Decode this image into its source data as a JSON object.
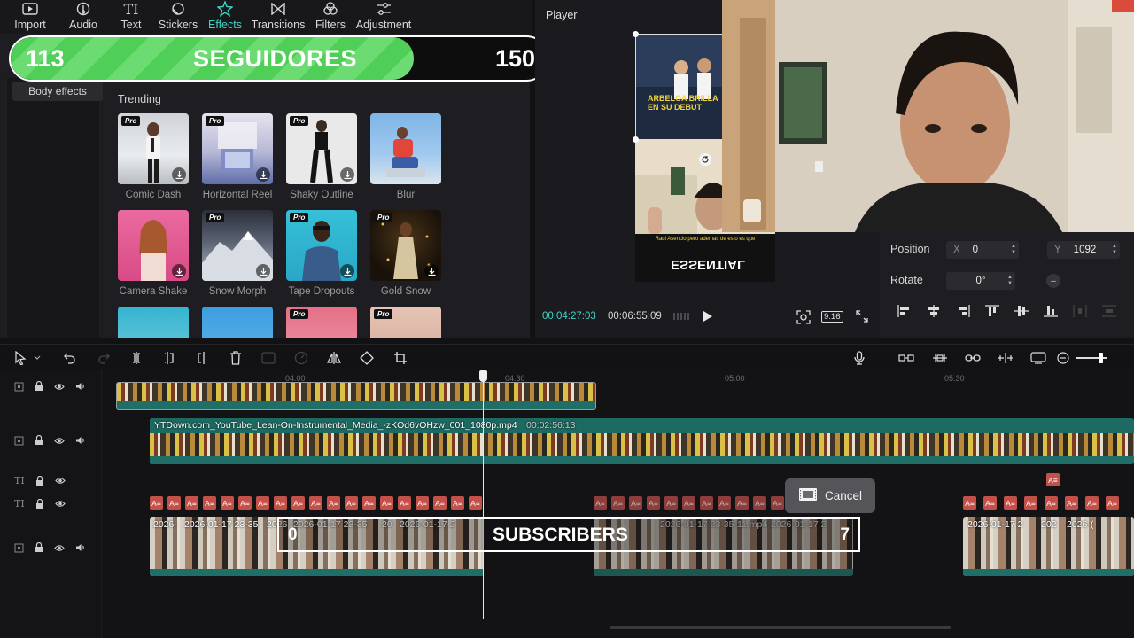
{
  "toolbar": {
    "tabs": [
      {
        "label": "Import",
        "icon": "import-icon"
      },
      {
        "label": "Audio",
        "icon": "audio-icon"
      },
      {
        "label": "Text",
        "icon": "text-icon"
      },
      {
        "label": "Stickers",
        "icon": "stickers-icon"
      },
      {
        "label": "Effects",
        "icon": "effects-icon",
        "active": true
      },
      {
        "label": "Transitions",
        "icon": "transitions-icon"
      },
      {
        "label": "Filters",
        "icon": "filters-icon"
      },
      {
        "label": "Adjustment",
        "icon": "adjustment-icon"
      }
    ]
  },
  "counter": {
    "start": "113",
    "title": "SEGUIDORES",
    "end": "150",
    "progress_fraction": 0.75,
    "fill_color": "#4fcf57"
  },
  "effects_panel": {
    "category": "Body effects",
    "section_title": "Trending",
    "items": [
      {
        "name": "Comic Dash",
        "pro": true
      },
      {
        "name": "Horizontal Reel",
        "pro": true
      },
      {
        "name": "Shaky Outline",
        "pro": true
      },
      {
        "name": "Blur",
        "pro": false
      },
      {
        "name": "Camera Shake",
        "pro": false
      },
      {
        "name": "Snow Morph",
        "pro": true
      },
      {
        "name": "Tape Dropouts",
        "pro": true
      },
      {
        "name": "Gold Snow",
        "pro": true
      }
    ],
    "pro_badge": "Pro"
  },
  "player": {
    "title": "Player",
    "current_time": "00:04:27:03",
    "total_time": "00:06:55:09",
    "ratio": "9:16",
    "preview_caption_1": "ARBELOA BRILLA EN SU DEBUT",
    "preview_caption_2": "Raul Asencio pero ademas de esto es que",
    "preview_caption_3": "ESSENTIAL"
  },
  "properties": {
    "position_label": "Position",
    "x_axis": "X",
    "x_value": "0",
    "y_axis": "Y",
    "y_value": "1092",
    "rotate_label": "Rotate",
    "rotate_value": "0°",
    "reset_symbol": "–"
  },
  "timeline": {
    "ruler": [
      "04:00",
      "04:30",
      "05:00",
      "05:30"
    ],
    "audio_clip_name": "YTDown.com_YouTube_Lean-On-Instrumental_Media_-zKOd6vOHzw_001_1080p.mp4",
    "audio_clip_duration": "00:02:56:13",
    "text_chip": "A≡",
    "video_clips": [
      "2026-",
      "2026-01-17 23-35",
      "2026",
      "2026-01-17 23-35-",
      "20",
      "2026-01-17 2",
      "2026-01-17 23-35-11.mp4",
      "2026-01-17 2",
      "2026-01-17 2",
      "202",
      "2026-("
    ]
  },
  "subscribers": {
    "start": "0",
    "title": "SUBSCRIBERS",
    "end": "7"
  },
  "cancel_label": "Cancel",
  "colors": {
    "accent": "#3fd4c4",
    "text_clip": "#c4504a",
    "track_teal": "#1f6e67"
  }
}
